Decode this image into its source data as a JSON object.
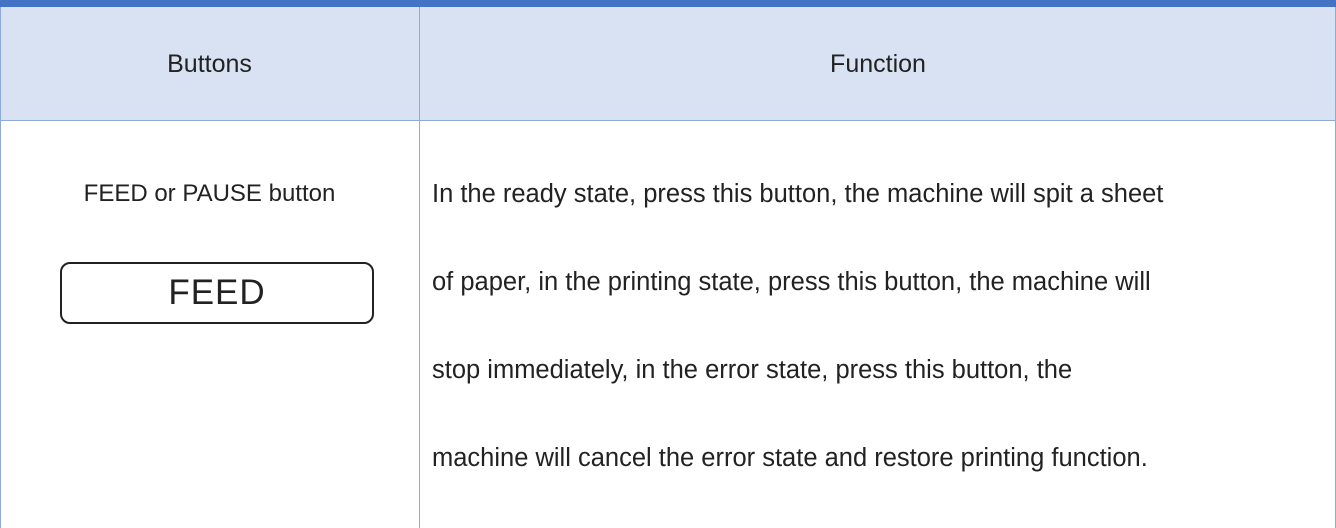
{
  "table": {
    "headers": {
      "buttons": "Buttons",
      "function": "Function"
    },
    "rows": [
      {
        "button_name": "FEED or PAUSE button",
        "key_label": "FEED",
        "function_lines": [
          "In the ready state, press this button, the machine will spit a sheet",
          "of paper, in the printing state, press this button, the machine will",
          "stop immediately, in the error state, press this button, the",
          "machine will cancel the error state and restore printing function."
        ]
      }
    ]
  },
  "colors": {
    "header_background": "#d9e2f3",
    "top_rule": "#4472c4",
    "grid_lines": "#8eaadb",
    "text": "#222222"
  }
}
